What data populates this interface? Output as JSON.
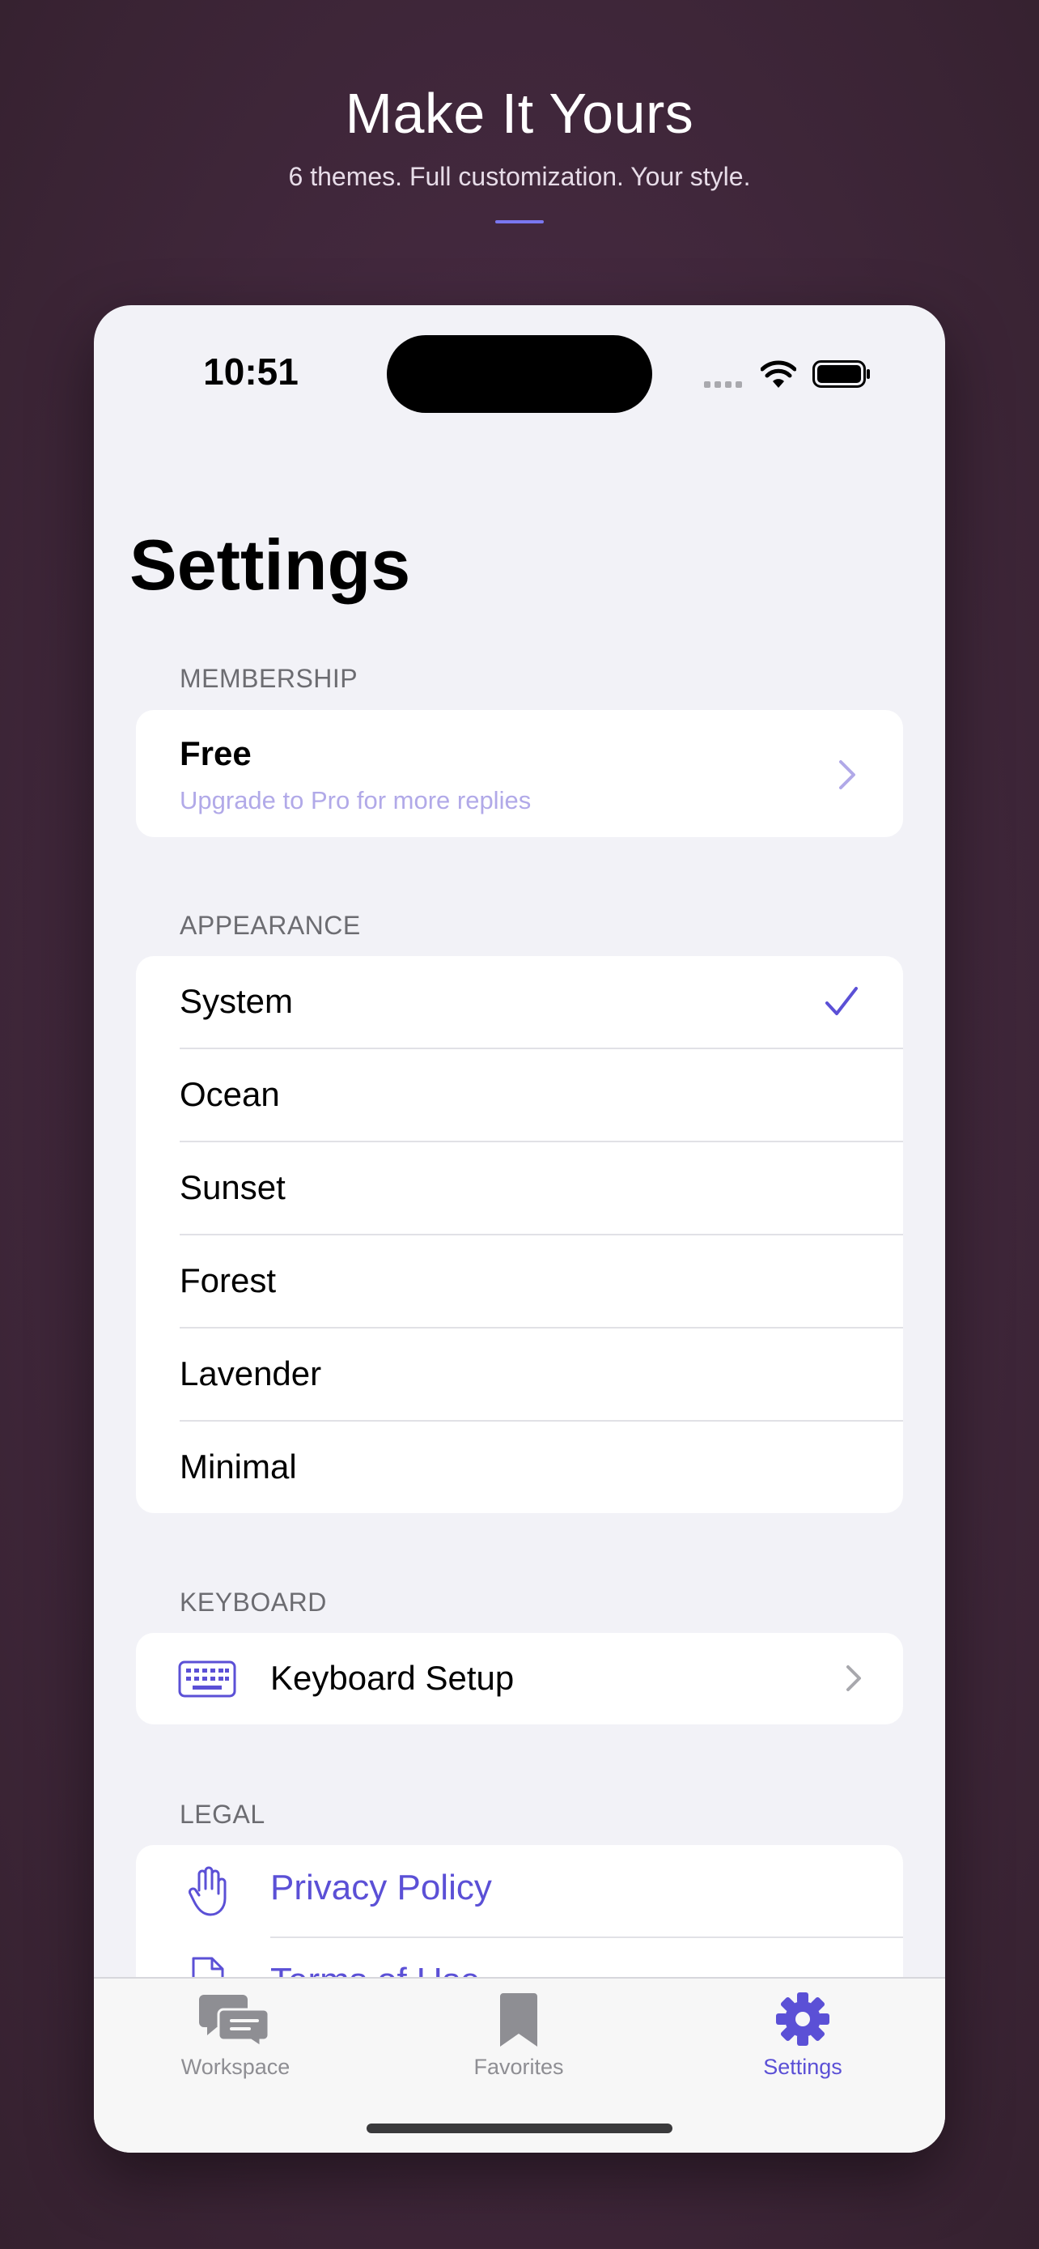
{
  "promo": {
    "title": "Make It Yours",
    "subtitle": "6 themes. Full customization. Your style."
  },
  "status_bar": {
    "time": "10:51"
  },
  "page": {
    "title": "Settings"
  },
  "membership": {
    "header": "MEMBERSHIP",
    "plan": "Free",
    "subtitle": "Upgrade to Pro for more replies"
  },
  "appearance": {
    "header": "APPEARANCE",
    "selected": "System",
    "themes": [
      "System",
      "Ocean",
      "Sunset",
      "Forest",
      "Lavender",
      "Minimal"
    ]
  },
  "keyboard": {
    "header": "KEYBOARD",
    "setup_label": "Keyboard Setup"
  },
  "legal": {
    "header": "LEGAL",
    "items": [
      "Privacy Policy",
      "Terms of Use"
    ]
  },
  "tabbar": {
    "items": [
      "Workspace",
      "Favorites",
      "Settings"
    ],
    "active": "Settings"
  },
  "colors": {
    "accent": "#5b50d6",
    "background": "#f2f2f7",
    "card": "#ffffff",
    "page_background": "#44293f"
  },
  "icons": {
    "check": "checkmark-icon",
    "chevron": "chevron-right-icon",
    "keyboard": "keyboard-icon",
    "privacy": "hand-raised-icon",
    "terms": "document-icon",
    "workspace": "chat-bubbles-icon",
    "favorites": "bookmark-icon",
    "settings": "gear-icon"
  }
}
